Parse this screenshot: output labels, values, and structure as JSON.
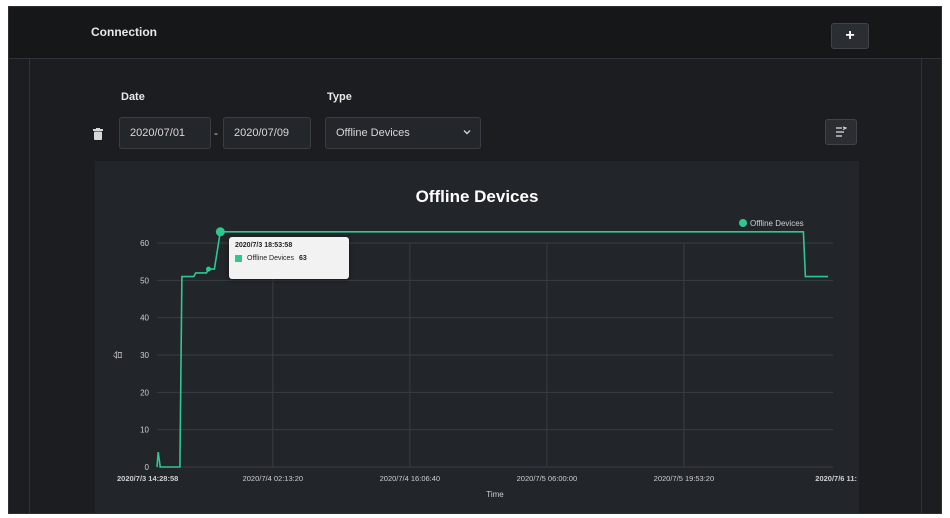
{
  "header": {
    "title": "Connection",
    "add_label": "+"
  },
  "filters": {
    "date_label": "Date",
    "type_label": "Type",
    "start_date": "2020/07/01",
    "separator": "-",
    "end_date": "2020/07/09",
    "type_selected": "Offline Devices"
  },
  "icons": {
    "delete": "trash-icon",
    "type_dropdown": "chevron-down-icon",
    "export": "export-icon"
  },
  "colors": {
    "series": "#2ec88e",
    "background": "#1b1d20",
    "panel": "#222529"
  },
  "tooltip": {
    "time": "2020/7/3 18:53:58",
    "series": "Offline Devices",
    "value": "63"
  },
  "chart_data": {
    "type": "line",
    "title": "Offline Devices",
    "xlabel": "Time",
    "ylabel": "台",
    "ylim": [
      0,
      60
    ],
    "y_ticks": [
      0,
      10,
      20,
      30,
      40,
      50,
      60
    ],
    "y_tick_labels": [
      "0",
      "10",
      "20",
      "30",
      "40",
      "50",
      "60"
    ],
    "x_tick_labels": [
      "2020/7/3 14:28:58",
      "2020/7/4 02:13:20",
      "2020/7/4 16:06:40",
      "2020/7/5 06:00:00",
      "2020/7/5 19:53:20",
      "2020/7/6 11:"
    ],
    "x_ticks_hours": [
      14.48,
      26.22,
      40.11,
      54.0,
      67.89,
      83.0
    ],
    "legend_position": "top-right",
    "grid": true,
    "series": [
      {
        "name": "Offline Devices",
        "x_hours": [
          14.48,
          14.6,
          14.8,
          15.2,
          15.25,
          16.5,
          16.8,
          17.0,
          18.2,
          18.4,
          19.5,
          19.7,
          20.3,
          20.9,
          80.0,
          80.2,
          82.5
        ],
        "values": [
          0,
          4,
          0,
          0,
          0,
          0,
          0,
          51,
          51,
          52,
          52,
          53,
          53,
          63,
          63,
          51,
          51
        ],
        "marker_hours": [
          19.7,
          20.9
        ],
        "marker_values": [
          53,
          63
        ]
      }
    ]
  }
}
